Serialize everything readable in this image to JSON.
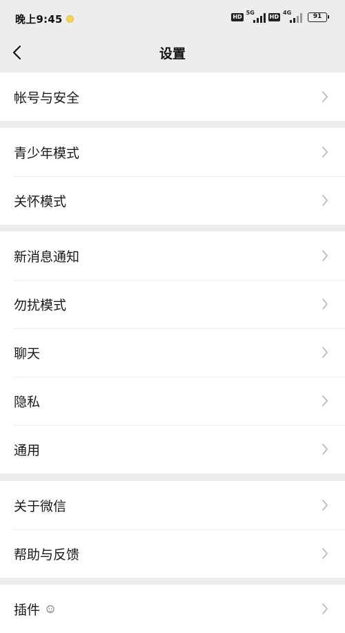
{
  "status_bar": {
    "time": "晚上9:45",
    "network1": "5G",
    "network2": "4G",
    "hd1": "HD",
    "hd2": "HD",
    "battery": "91"
  },
  "header": {
    "title": "设置"
  },
  "groups": [
    {
      "items": [
        {
          "label": "帐号与安全"
        }
      ]
    },
    {
      "items": [
        {
          "label": "青少年模式"
        },
        {
          "label": "关怀模式"
        }
      ]
    },
    {
      "items": [
        {
          "label": "新消息通知"
        },
        {
          "label": "勿扰模式"
        },
        {
          "label": "聊天"
        },
        {
          "label": "隐私"
        },
        {
          "label": "通用"
        }
      ]
    },
    {
      "items": [
        {
          "label": "关于微信"
        },
        {
          "label": "帮助与反馈"
        }
      ]
    },
    {
      "items": [
        {
          "label": "插件"
        }
      ]
    }
  ],
  "icons": {
    "back": "chevron-left-icon",
    "row_arrow": "chevron-right-icon",
    "plugin_badge": "plugin-badge-icon"
  },
  "colors": {
    "background": "#ededed",
    "row_background": "#ffffff",
    "text": "#191919",
    "chevron": "#b2b2b2",
    "divider": "#ececec"
  }
}
